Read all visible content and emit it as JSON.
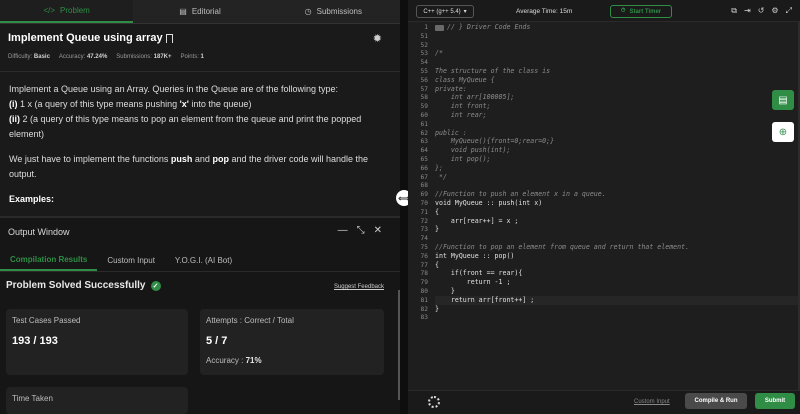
{
  "tabs": [
    {
      "label": "Problem",
      "icon": "code-icon"
    },
    {
      "label": "Editorial",
      "icon": "document-icon"
    },
    {
      "label": "Submissions",
      "icon": "clock-icon"
    }
  ],
  "problem": {
    "title": "Implement Queue using array",
    "meta": {
      "difficulty_label": "Difficulty:",
      "difficulty": "Basic",
      "accuracy_label": "Accuracy:",
      "accuracy": "47.24%",
      "submissions_label": "Submissions:",
      "submissions": "187K+",
      "points_label": "Points:",
      "points": "1"
    },
    "desc_intro": "Implement a Queue using an Array. Queries in the Queue are of the following type:",
    "q1_prefix": "(i)",
    "q1_text": " 1 x    (a query of this type means  pushing ",
    "q1_bold": "'x'",
    "q1_end": " into the queue)",
    "q2_prefix": "(ii)",
    "q2_text": " 2     (a query of this type means to pop an element from the queue and print the popped element)",
    "desc_2a": "We just have to implement the functions ",
    "push": "push",
    "and": " and ",
    "pop": "pop",
    "desc_2b": " and the driver code will handle the output.",
    "examples": "Examples:"
  },
  "output": {
    "title": "Output Window",
    "tabs": [
      "Compilation Results",
      "Custom Input",
      "Y.O.G.I. (AI Bot)"
    ],
    "status": "Problem Solved Successfully",
    "feedback": "Suggest Feedback",
    "cards": {
      "tests_label": "Test Cases Passed",
      "tests_value": "193 / 193",
      "attempts_label": "Attempts : Correct / Total",
      "attempts_value": "5 / 7",
      "accuracy_label": "Accuracy : ",
      "accuracy_value": "71%",
      "time_label": "Time Taken"
    }
  },
  "editor": {
    "language": "C++ (g++ 5.4)",
    "avg_time": "Average Time: 15m",
    "timer": "Start Timer",
    "lines": [
      {
        "n": "1",
        "t": "// } Driver Code Ends",
        "c": "cm",
        "fold": true
      },
      {
        "n": "51",
        "t": "",
        "c": ""
      },
      {
        "n": "52",
        "t": "",
        "c": ""
      },
      {
        "n": "53",
        "t": "/*",
        "c": "cm"
      },
      {
        "n": "54",
        "t": "",
        "c": ""
      },
      {
        "n": "55",
        "t": "The structure of the class is",
        "c": "cm"
      },
      {
        "n": "56",
        "t": "class MyQueue {",
        "c": "cm"
      },
      {
        "n": "57",
        "t": "private:",
        "c": "cm"
      },
      {
        "n": "58",
        "t": "    int arr[100005];",
        "c": "cm"
      },
      {
        "n": "59",
        "t": "    int front;",
        "c": "cm"
      },
      {
        "n": "60",
        "t": "    int rear;",
        "c": "cm"
      },
      {
        "n": "61",
        "t": "",
        "c": ""
      },
      {
        "n": "62",
        "t": "public :",
        "c": "cm"
      },
      {
        "n": "63",
        "t": "    MyQueue(){front=0;rear=0;}",
        "c": "cm"
      },
      {
        "n": "64",
        "t": "    void push(int);",
        "c": "cm"
      },
      {
        "n": "65",
        "t": "    int pop();",
        "c": "cm"
      },
      {
        "n": "66",
        "t": "};",
        "c": "cm"
      },
      {
        "n": "67",
        "t": " */",
        "c": "cm"
      },
      {
        "n": "68",
        "t": "",
        "c": ""
      },
      {
        "n": "69",
        "t": "//Function to push an element x in a queue.",
        "c": "cm"
      },
      {
        "n": "70",
        "t": "void MyQueue :: push(int x)",
        "c": ""
      },
      {
        "n": "71",
        "t": "{",
        "c": ""
      },
      {
        "n": "72",
        "t": "    arr[rear++] = x ;",
        "c": ""
      },
      {
        "n": "73",
        "t": "}",
        "c": ""
      },
      {
        "n": "74",
        "t": "",
        "c": ""
      },
      {
        "n": "75",
        "t": "//Function to pop an element from queue and return that element.",
        "c": "cm"
      },
      {
        "n": "76",
        "t": "int MyQueue :: pop()",
        "c": ""
      },
      {
        "n": "77",
        "t": "{",
        "c": ""
      },
      {
        "n": "78",
        "t": "    if(front == rear){",
        "c": ""
      },
      {
        "n": "79",
        "t": "        return -1 ;",
        "c": ""
      },
      {
        "n": "80",
        "t": "    }",
        "c": ""
      },
      {
        "n": "81",
        "t": "    return arr[front++] ;",
        "c": "hl"
      },
      {
        "n": "82",
        "t": "}",
        "c": ""
      },
      {
        "n": "83",
        "t": "",
        "c": ""
      }
    ],
    "custom_input": "Custom Input",
    "compile": "Compile & Run",
    "submit": "Submit"
  },
  "colors": {
    "accent": "#2f8d46",
    "bg": "#1e1e1e"
  }
}
